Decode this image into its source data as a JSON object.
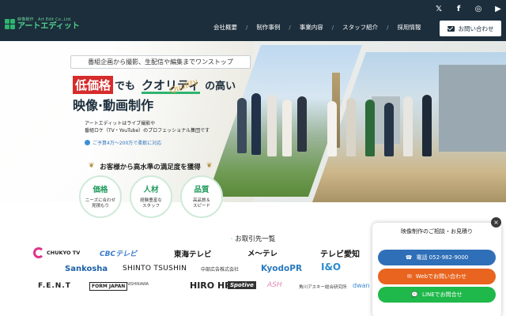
{
  "header": {
    "logo_sub": "映像制作　Art Edit Co.,Ltd.",
    "logo_main": "アートエディット",
    "social": [
      {
        "icon": "x-icon",
        "glyph": "𝕏"
      },
      {
        "icon": "facebook-icon",
        "glyph": "f"
      },
      {
        "icon": "instagram-icon",
        "glyph": "◎"
      },
      {
        "icon": "youtube-icon",
        "glyph": "▶"
      }
    ],
    "nav": [
      "会社概要",
      "制作事例",
      "事業内容",
      "スタッフ紹介",
      "採用情報"
    ],
    "contact_label": "お問い合わせ"
  },
  "hero": {
    "tagline": "番組企画から撮影、生配信や編集までワンストップ",
    "headline_red": "低価格",
    "headline_de": "でも",
    "headline_quality": "クオリティ",
    "headline_takai": "の高い",
    "script_text": "Quality",
    "headline2": "映像·動画制作",
    "desc_line1": "アートエディットはライブ撮影や",
    "desc_line2": "番組ロケ（TV・YouTube）のプロフェッショナル集団です",
    "budget": "ご予算4万〜200万で柔軟に対応",
    "satisfaction": "お客様から高水準の満足度を獲得",
    "badges": [
      {
        "title": "価格",
        "line1": "ニーズに合わせ",
        "line2": "見積もり"
      },
      {
        "title": "人材",
        "line1": "経験豊富な",
        "line2": "スタッフ"
      },
      {
        "title": "品質",
        "line1": "高品質＆",
        "line2": "スピード"
      }
    ]
  },
  "clients": {
    "title": "お取引先一覧",
    "row1": [
      "CHUKYO TV",
      "CBCテレビ",
      "東海テレビ",
      "メ〜テレ",
      "テレビ愛知"
    ],
    "row2": [
      "Sankosha",
      "SHINTO TSUSHIN",
      "中部広告株式会社",
      "KyodoPR",
      "I&O"
    ],
    "row3": [
      "F.E.N.T",
      "FORM JAPAN",
      "NISHIKAWA",
      "HIRO HP",
      "Spotive",
      "ASH",
      "角川アスキー総合研究所",
      "dwan"
    ]
  },
  "widget": {
    "title": "映像制作のご相談・お見積り",
    "phone": "電話 052-982-9000",
    "web": "Webでお問い合わせ",
    "line": "LINEでお問合せ",
    "close": "×"
  },
  "colors": {
    "header_bg": "#1c2e3c",
    "brand_green": "#2eb46f",
    "accent_red": "#d62c2c",
    "phone_btn": "#2f6fb8",
    "web_btn": "#e8641f",
    "line_btn": "#1fb84a"
  }
}
